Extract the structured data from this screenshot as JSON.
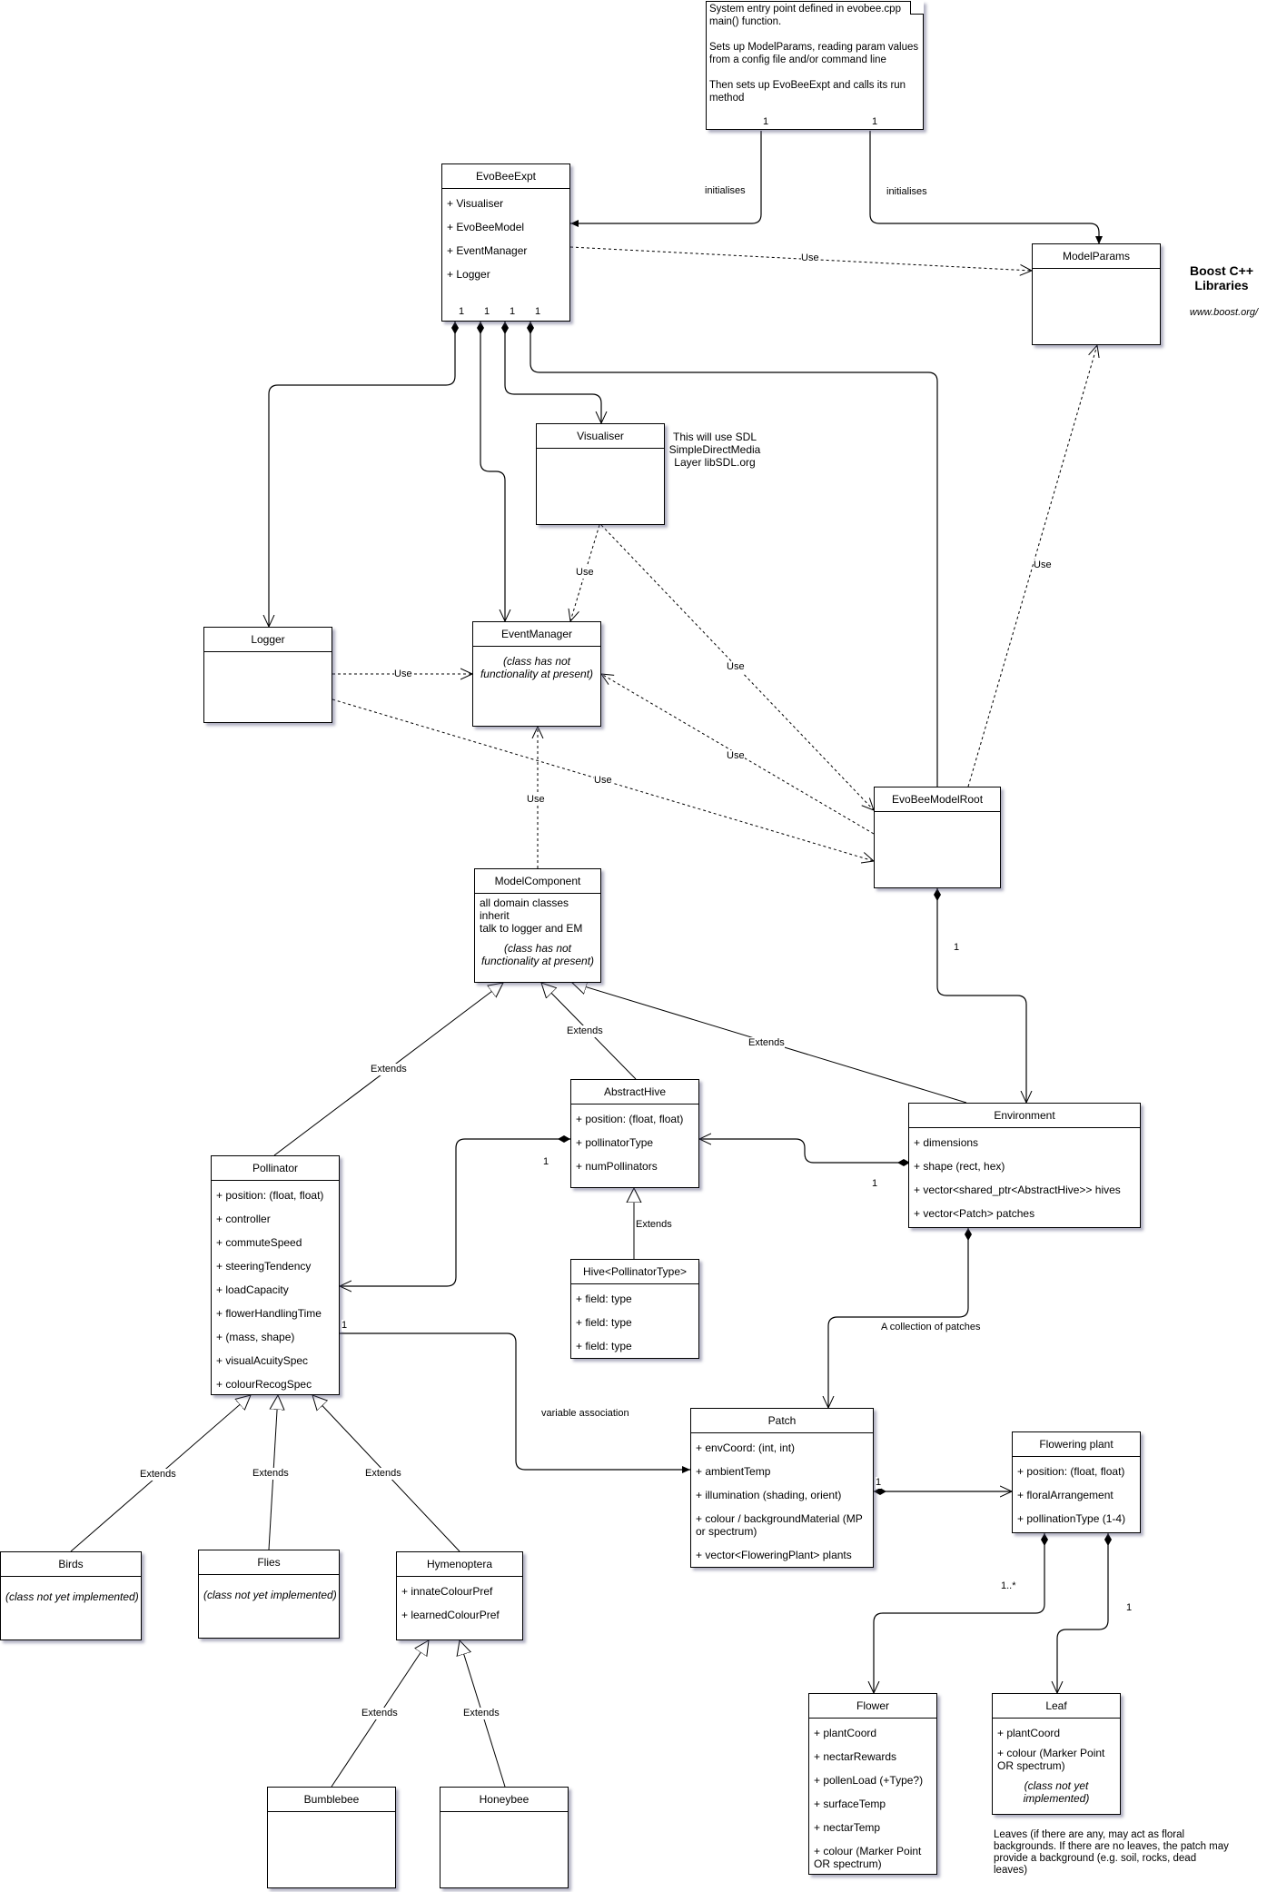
{
  "note": {
    "paragraphs": [
      "System entry point defined in evobee.cpp main() function.",
      "Sets up ModelParams, reading param values from a config file and/or command line",
      "Then sets up EvoBeeExpt and calls its run method"
    ],
    "multiplicities": [
      "1",
      "1"
    ]
  },
  "classes": {
    "evobeeexpt": {
      "name": "EvoBeeExpt",
      "attrs": [
        "+ Visualiser",
        "+ EvoBeeModel",
        "+ EventManager",
        "+ Logger"
      ],
      "multiplicities": [
        "1",
        "1",
        "1",
        "1"
      ]
    },
    "modelparams": {
      "name": "ModelParams"
    },
    "visualiser": {
      "name": "Visualiser"
    },
    "logger": {
      "name": "Logger"
    },
    "eventmanager": {
      "name": "EventManager",
      "note": "(class has not functionality at present)"
    },
    "evobeemodelroot": {
      "name": "EvoBeeModelRoot"
    },
    "modelcomponent": {
      "name": "ModelComponent",
      "lines": [
        "all domain classes",
        "inherit",
        "talk to logger and EM"
      ],
      "note": "(class has not functionality at present)"
    },
    "abstracthive": {
      "name": "AbstractHive",
      "attrs": [
        "+ position: (float, float)",
        "+ pollinatorType",
        "+ numPollinators"
      ]
    },
    "hive": {
      "name": "Hive<PollinatorType>",
      "attrs": [
        "+ field: type",
        "+ field: type",
        "+ field: type"
      ]
    },
    "environment": {
      "name": "Environment",
      "attrs": [
        "+ dimensions",
        "+ shape (rect, hex)",
        "+ vector<shared_ptr<AbstractHive>> hives",
        "+ vector<Patch> patches"
      ]
    },
    "pollinator": {
      "name": "Pollinator",
      "attrs": [
        "+ position: (float, float)",
        "+ controller",
        "+ commuteSpeed",
        "+ steeringTendency",
        "+ loadCapacity",
        "+ flowerHandlingTime",
        "+ (mass, shape)",
        "+ visualAcuitySpec",
        "+ colourRecogSpec"
      ]
    },
    "patch": {
      "name": "Patch",
      "attrs": [
        "+ envCoord: (int, int)",
        "+ ambientTemp",
        "+ illumination (shading, orient)",
        "+ colour / backgroundMaterial (MP or spectrum)",
        "+ vector<FloweringPlant> plants"
      ]
    },
    "floweringplant": {
      "name": "Flowering plant",
      "attrs": [
        "+ position: (float, float)",
        "+ floralArrangement",
        "+ pollinationType (1-4)"
      ]
    },
    "birds": {
      "name": "Birds",
      "note": "(class not yet implemented)"
    },
    "flies": {
      "name": "Flies",
      "note": "(class not yet implemented)"
    },
    "hymenoptera": {
      "name": "Hymenoptera",
      "attrs": [
        "+ innateColourPref",
        "+ learnedColourPref"
      ]
    },
    "bumblebee": {
      "name": "Bumblebee"
    },
    "honeybee": {
      "name": "Honeybee"
    },
    "flower": {
      "name": "Flower",
      "attrs": [
        "+ plantCoord",
        "+ nectarRewards",
        "+ pollenLoad (+Type?)",
        "+ surfaceTemp",
        "+ nectarTemp",
        "+ colour (Marker Point OR spectrum)"
      ]
    },
    "leaf": {
      "name": "Leaf",
      "attrs": [
        "+ plantCoord",
        "+ colour (Marker Point OR spectrum)"
      ],
      "note": "(class not yet implemented)"
    }
  },
  "texts": {
    "boost_title": "Boost C++ Libraries",
    "boost_url": "www.boost.org/",
    "sdl_note": "This will use SDL SimpleDirectMedia Layer libSDL.org",
    "leaves_note": "Leaves (if there are any, may act as floral backgrounds. If there are no leaves, the patch may provide a background (e.g. soil, rocks, dead leaves)"
  },
  "edge_labels": {
    "initialises_1": "initialises",
    "initialises_2": "initialises",
    "use_expt_params": "Use",
    "use_root_params": "Use",
    "use_vis_em": "Use",
    "use_logger_em": "Use",
    "use_vis_root": "Use",
    "use_root_em": "Use",
    "use_logger_root": "Use",
    "use_mc_em": "Use",
    "extends_pollinator": "Extends",
    "extends_hive": "Extends",
    "extends_env": "Extends",
    "extends_hivet": "Extends",
    "extends_birds": "Extends",
    "extends_flies": "Extends",
    "extends_hymen": "Extends",
    "extends_bumble": "Extends",
    "extends_honey": "Extends",
    "collection_patches": "A collection of patches",
    "variable_assoc": "variable association"
  },
  "multiplicities": {
    "root_env": "1",
    "env_hive": "1",
    "hive_pollinator": "1",
    "pollinator_patch": "1",
    "patch_plant": "1",
    "plant_flower": "1..*",
    "plant_leaf": "1"
  }
}
